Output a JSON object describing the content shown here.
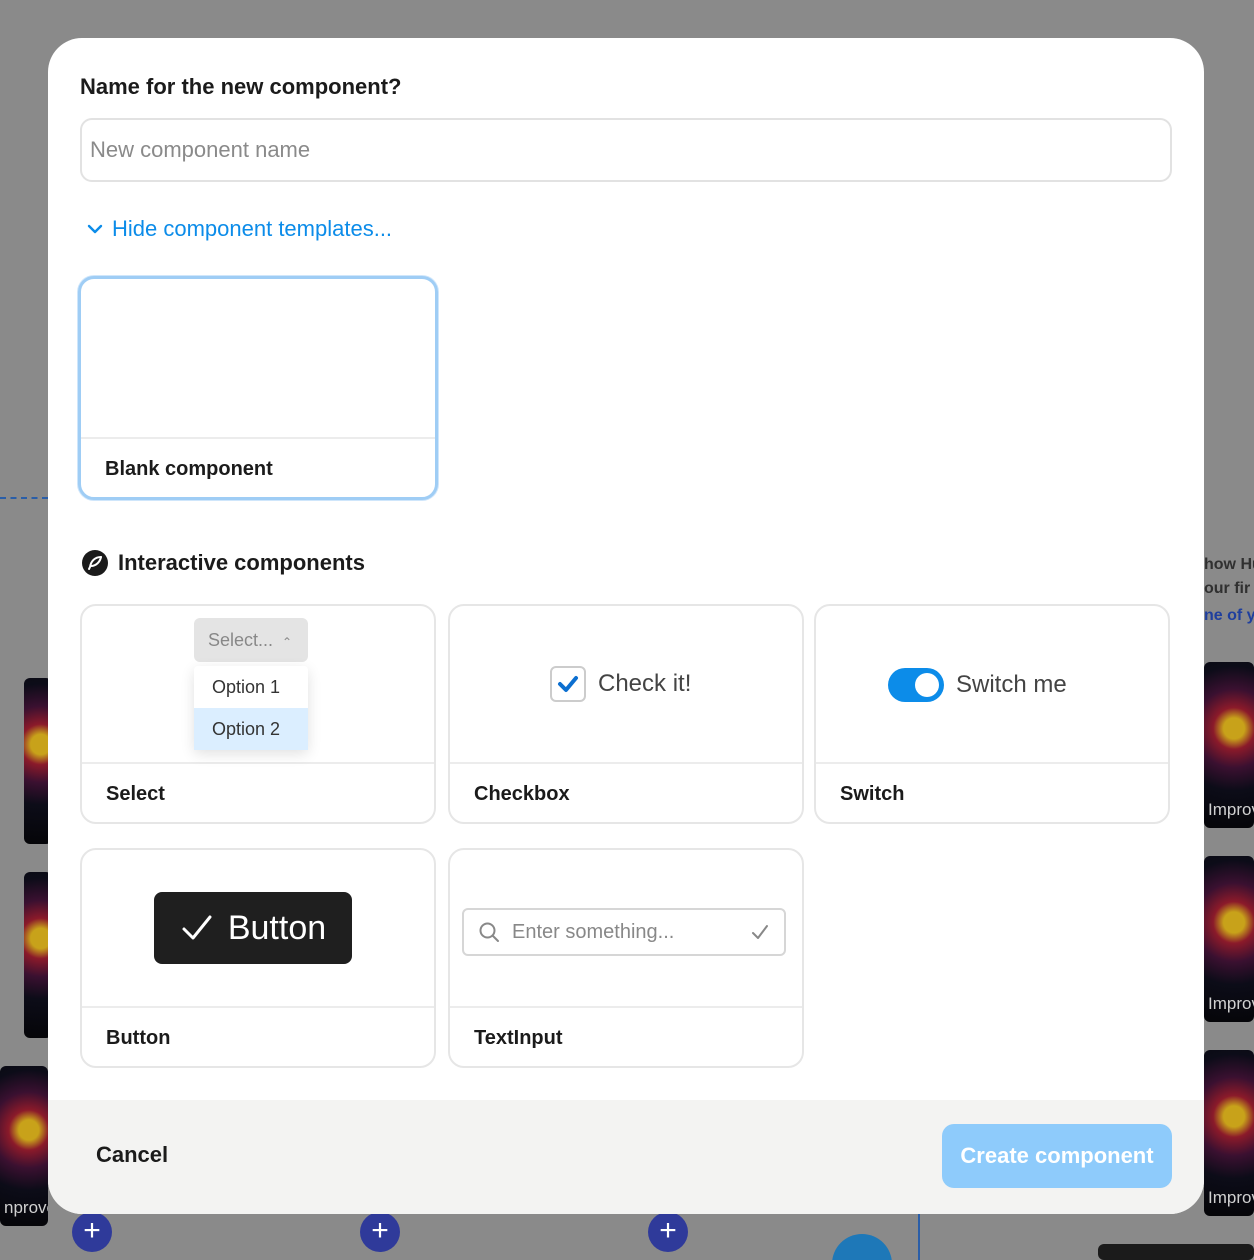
{
  "modal": {
    "question": "Name for the new component?",
    "name_placeholder": "New component name",
    "toggle_templates_label": "Hide component templates...",
    "blank_card_title": "Blank component",
    "section_title": "Interactive components",
    "templates": {
      "select": {
        "title": "Select",
        "button_text": "Select...",
        "option_1": "Option 1",
        "option_2": "Option 2"
      },
      "checkbox": {
        "title": "Checkbox",
        "label": "Check it!"
      },
      "switch": {
        "title": "Switch",
        "label": "Switch me"
      },
      "button": {
        "title": "Button",
        "label": "Button"
      },
      "textinput": {
        "title": "TextInput",
        "placeholder": "Enter something..."
      }
    },
    "footer": {
      "cancel_label": "Cancel",
      "create_label": "Create component"
    }
  },
  "background": {
    "improve_label_left": "nprovem",
    "improve_label_right": "Improv",
    "side_text_1": "how Hu",
    "side_text_2": "our fir",
    "side_link": "ne of y",
    "plus": "+"
  },
  "colors": {
    "accent": "#0c8ce9",
    "create_button": "#8ecbfb",
    "selected_border": "#9fcdf5",
    "overlay": "#8a8a8a"
  }
}
